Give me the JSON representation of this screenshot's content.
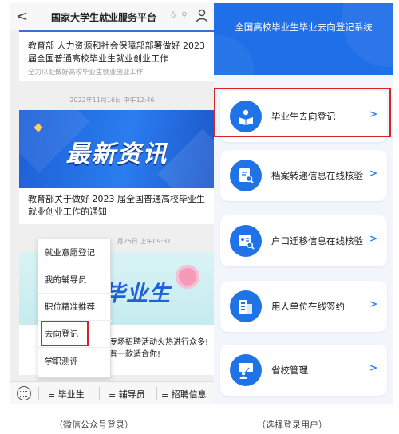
{
  "left_screen": {
    "header": {
      "back_label": "<",
      "title": "国家大学生就业服务平台",
      "title_icons": "ô ⚲"
    },
    "article1": {
      "title": "教育部 人力资源和社会保障部部署做好 2023 届全国普通高校毕业生就业创业工作",
      "subtitle": "全力以赴做好高校毕业生就业创业工作"
    },
    "timestamp1": "2022年11月16日 中午12:46",
    "article2": {
      "banner_text": "最新资讯",
      "title": "教育部关于做好 2023 届全国普通高校毕业生就业创业工作的通知"
    },
    "timestamp2": "月25日 上午09:31",
    "article3": {
      "banner_text": "校毕业生",
      "title": "业专场招聘活动火热进行众多! 总有一款适合你!"
    },
    "popup_menu": [
      "就业意愿登记",
      "我的辅导员",
      "职位精准推荐",
      "去向登记",
      "学职测评"
    ],
    "bottom_tabs": [
      "毕业生",
      "辅导员",
      "招聘信息"
    ],
    "caption": "（微信公众号登录）"
  },
  "right_screen": {
    "title": "全国高校毕业生毕业去向登记系统",
    "items": [
      {
        "label": "毕业生去向登记",
        "icon": "book-reader-icon",
        "arrow": ">"
      },
      {
        "label": "档案转递信息在线核验",
        "icon": "document-search-icon",
        "arrow": ">"
      },
      {
        "label": "户口迁移信息在线核验",
        "icon": "id-card-icon",
        "arrow": ">"
      },
      {
        "label": "用人单位在线签约",
        "icon": "building-icon",
        "arrow": ">"
      },
      {
        "label": "省校管理",
        "icon": "presenter-icon",
        "arrow": ">"
      }
    ],
    "caption": "（选择登录用户）"
  },
  "colors": {
    "primary_blue": "#2e7ff0",
    "highlight_red": "#d8232a"
  }
}
